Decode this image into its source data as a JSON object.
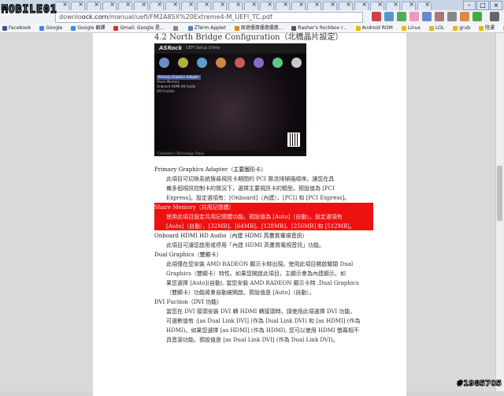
{
  "logo": "MOBILE01",
  "browser": {
    "url_prefix": "downlo",
    "url_host": "ock.com",
    "url_path": "/manual/uefi/FM2A85X%20Extreme4-M_UEFI_TC.pdf",
    "window_buttons": [
      "–",
      "□",
      "×"
    ],
    "tab_close": "×"
  },
  "bookmarks": [
    {
      "label": "Facebook",
      "color": "#3b5998"
    },
    {
      "label": "Google",
      "color": "#4285f4"
    },
    {
      "label": "Google 翻譯",
      "color": "#4285f4"
    },
    {
      "label": "Gmail: Google 是...",
      "color": "#d93025"
    },
    {
      "label": "",
      "color": "#888888"
    },
    {
      "label": "ZTerm Applet",
      "color": "#5a7bb5"
    },
    {
      "label": "周遊優惠優惠優惠...",
      "color": "#e08a00"
    },
    {
      "label": "Rasher's Rockbox r...",
      "color": "#555555"
    },
    {
      "label": "Android ROM",
      "color": "#e6b800"
    },
    {
      "label": "Linux",
      "color": "#e6b800"
    },
    {
      "label": "LOL",
      "color": "#e6b800"
    },
    {
      "label": "grub",
      "color": "#e6b800"
    },
    {
      "label": "陸運",
      "color": "#e6b800"
    },
    {
      "label": "網頁",
      "color": "#e6b800"
    }
  ],
  "document": {
    "heading": "4.2     North Bridge Configuration（北橋晶片設定）",
    "screenshot": {
      "brand": "ASRock",
      "subtitle": "UEFI  Setup Utility",
      "menu": [
        "Primary Graphics Adapter",
        "Share Memory",
        "Onboard HDMI HD Audio",
        "DVI Fuction"
      ],
      "footer": "Customer's Technology Today"
    },
    "lines": [
      "Primary Graphics Adapter（主要圖形卡）",
      "此項目可切換系統搜尋視訊卡期間的 PCI 匯流排掃描順序。讓您在具",
      "備多個視訊控制卡的情況下，選擇主要視訊卡的類型。預設值為 [PCI",
      "Express]。設定選項有：[Onboard]（內建）、[PCI] 和 [PCI Express]。",
      "Share Memory（共用記憶體）",
      "使用此項目設定共用記憶體功能。預設值為 [Auto]（自動）。設定選項有",
      "[Auto]（自動）、[32MB]、[64MB]、[128MB]、[256MB] 和 [512MB]。",
      "Onboard HDMI HD Audio（內建 HDMI 高畫質電視音訊）",
      "此項目可讓您啟用或停用「內建 HDMI 高畫質電視音訊」功能。",
      "Dual Graphics（雙顯卡）",
      "此項僅在您安裝 AMD RADEON 顯示卡時出現。使用此項目開啟關閉 Dual",
      "Graphics（雙顯卡）特性。如果您開啟此項目，主顯示會為內建顯示。如",
      "果您選擇 [Auto](自動), 當您安裝 AMD RADEON 顯示卡時 ,Dual Graphics",
      "（雙顯卡）功能將會自動被開啟。預設值是 [Auto]（自動）。",
      "DVI Fuction（DVI 功能）",
      "當您在 DVI 接頭安裝 DVI 轉 HDMI 轉接頭時，請使用此項選擇 DVI 功能。",
      "可選數值有 :[as Dual Link DVI] (作為 Dual Link DVI) 和 [as HDMI] (作為",
      "HDMI)。如果您選擇 [as HDMI] (作為 HDMI), 您可以使用 HDMI 螢幕相不",
      "具音源功能。預設值是 [as Dual Link DVI] (作為 Dual Link DVI)。"
    ]
  },
  "watermark": "#1985705"
}
